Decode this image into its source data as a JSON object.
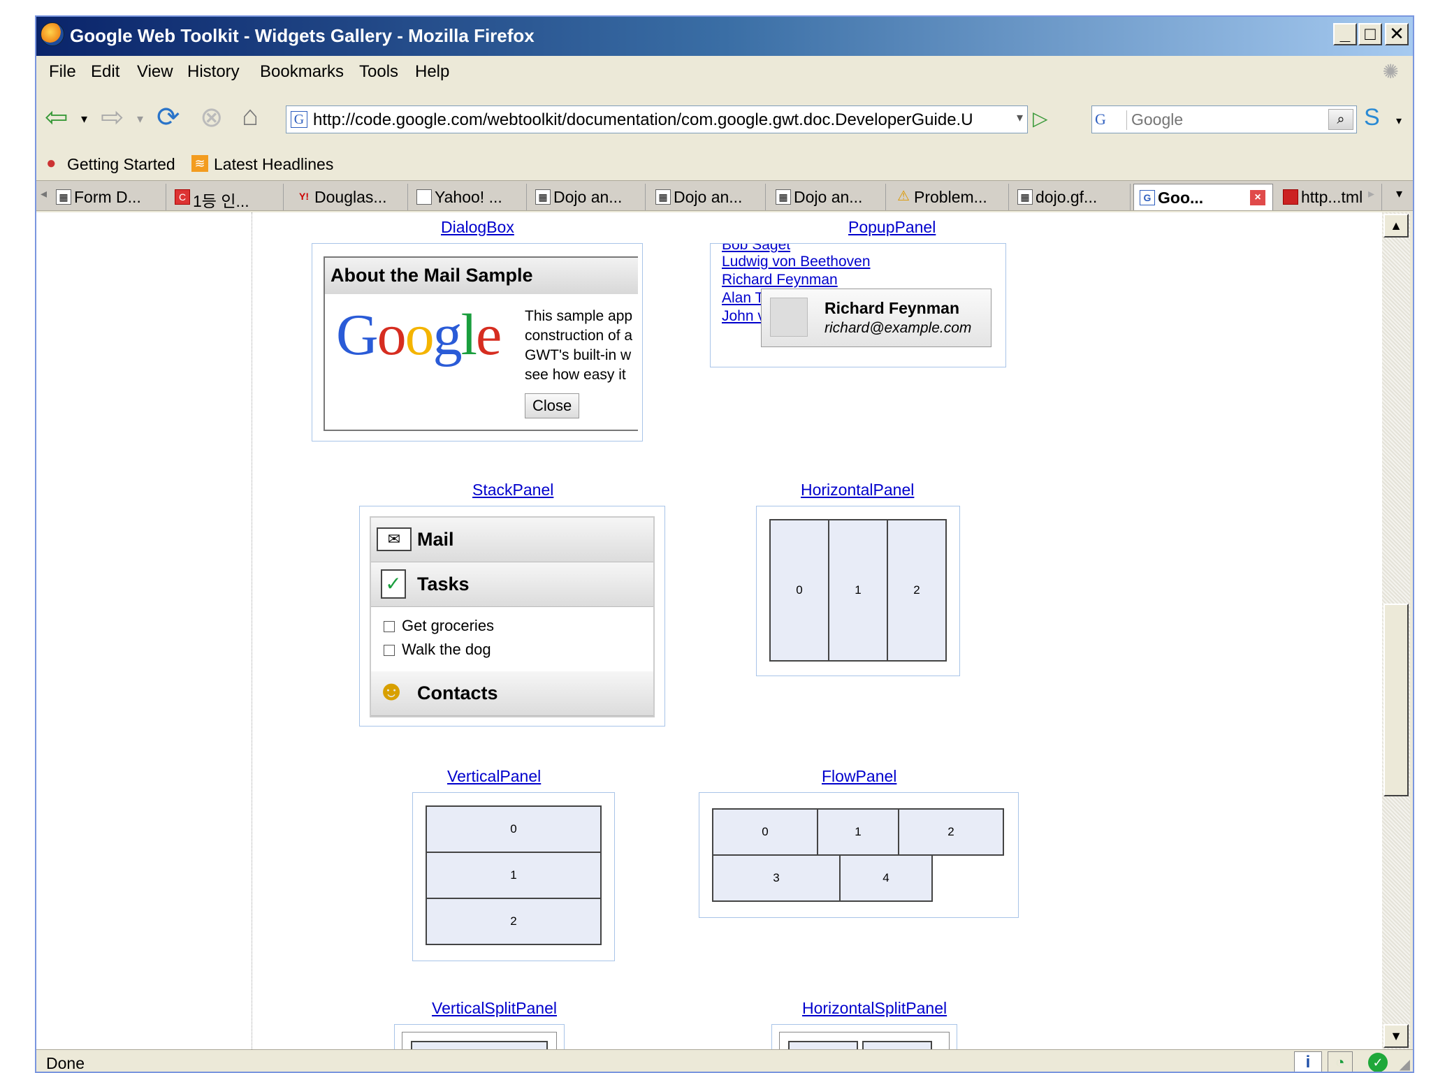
{
  "window": {
    "title": "Google Web Toolkit - Widgets Gallery - Mozilla Firefox"
  },
  "menu": [
    "File",
    "Edit",
    "View",
    "History",
    "Bookmarks",
    "Tools",
    "Help"
  ],
  "nav": {
    "url": "http://code.google.com/webtoolkit/documentation/com.google.gwt.doc.DeveloperGuide.U",
    "search_placeholder": "Google",
    "search_engine": "G"
  },
  "bookmarks": [
    "Getting Started",
    "Latest Headlines"
  ],
  "tabs": [
    "Form D...",
    "1등 인...",
    "Douglas...",
    "Yahoo! ...",
    "Dojo an...",
    "Dojo an...",
    "Dojo an...",
    "Problem...",
    "dojo.gf...",
    "Goo...",
    "http...tml"
  ],
  "gallery": {
    "dialogbox": {
      "label": "DialogBox",
      "caption": "About the Mail Sample",
      "logo_text": "Google",
      "body_lines": [
        "This sample app",
        "construction of a",
        "GWT's built-in w",
        "see how easy it"
      ],
      "close": "Close"
    },
    "popuppanel": {
      "label": "PopupPanel",
      "names": [
        "Bob Saget",
        "Ludwig von Beethoven",
        "Richard Feynman",
        "Alan T",
        "John v"
      ],
      "popup_name": "Richard Feynman",
      "popup_email": "richard@example.com"
    },
    "stackpanel": {
      "label": "StackPanel",
      "headers": [
        "Mail",
        "Tasks",
        "Contacts"
      ],
      "tasks": [
        "Get groceries",
        "Walk the dog"
      ]
    },
    "horizontalpanel": {
      "label": "HorizontalPanel",
      "cells": [
        "0",
        "1",
        "2"
      ]
    },
    "verticalpanel": {
      "label": "VerticalPanel",
      "cells": [
        "0",
        "1",
        "2"
      ]
    },
    "flowpanel": {
      "label": "FlowPanel",
      "cells": [
        "0",
        "1",
        "2",
        "3",
        "4"
      ]
    },
    "verticalsplitpanel": {
      "label": "VerticalSplitPanel"
    },
    "horizontalsplitpanel": {
      "label": "HorizontalSplitPanel"
    }
  },
  "status": {
    "text": "Done"
  },
  "colors": {
    "link": "#0000cc",
    "cell_bg": "#e8ecf7",
    "box_border": "#a8c4e8",
    "titlebar": "#0a246a"
  }
}
